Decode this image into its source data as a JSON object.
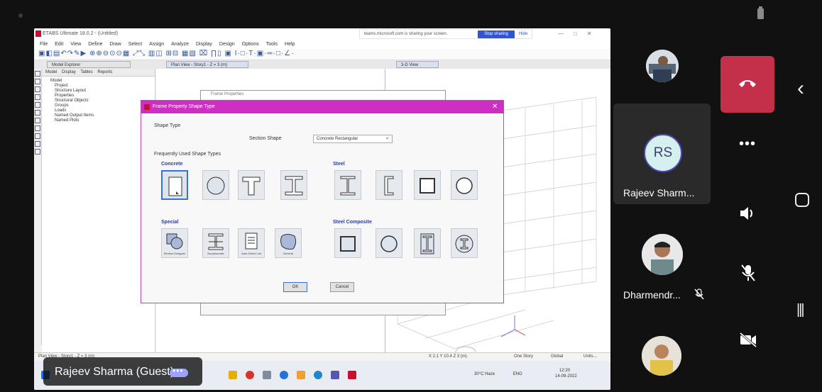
{
  "shared_window": {
    "app_title": "ETABS Ultimate 18.0.2 - (Untitled)",
    "share_banner": {
      "text": "teams.microsoft.com is sharing your screen.",
      "stop_label": "Stop sharing",
      "hide_label": "Hide"
    },
    "menu": [
      "File",
      "Edit",
      "View",
      "Define",
      "Draw",
      "Select",
      "Assign",
      "Analyze",
      "Display",
      "Design",
      "Options",
      "Tools",
      "Help"
    ],
    "panels": {
      "model_explorer": "Model Explorer",
      "plan_view": "Plan View - Story1 - Z = 3 (m)",
      "view_3d": "3-D View"
    },
    "explorer_tabs": [
      "Model",
      "Display",
      "Tables",
      "Reports"
    ],
    "tree": {
      "root": "Model",
      "children": [
        "Project",
        "Structure Layout",
        "Properties",
        "Structural Objects",
        "Groups",
        "Loads",
        "Named Output Items",
        "Named Plots"
      ]
    },
    "status_left": "Plan View - Story1 - Z = 3 (m)",
    "status_right": "X 2.1 Y 10.4 Z 3 (m)",
    "status_extra": [
      "One Story",
      "Global",
      "Units..."
    ]
  },
  "background_dialog": {
    "title": "Frame Properties"
  },
  "dialog": {
    "title": "Frame Property Shape Type",
    "section_label": "Shape Type",
    "section_shape_label": "Section Shape",
    "section_shape_value": "Concrete Rectangular",
    "frequent_label": "Frequently Used Shape Types",
    "groups": {
      "concrete": {
        "title": "Concrete",
        "shapes": [
          "rectangular",
          "circular",
          "tee",
          "i-section"
        ]
      },
      "steel": {
        "title": "Steel",
        "shapes": [
          "i-section",
          "channel",
          "box",
          "pipe"
        ]
      },
      "special": {
        "title": "Special",
        "shapes": [
          "section-designer",
          "nonprismatic",
          "auto-select",
          "general"
        ],
        "captions": [
          "Section Designer",
          "Nonprismatic",
          "Auto Select List",
          "General"
        ]
      },
      "steel_composite": {
        "title": "Steel Composite",
        "shapes": [
          "filled-box",
          "filled-pipe",
          "encased-rect",
          "encased-circle"
        ]
      }
    },
    "ok_label": "OK",
    "cancel_label": "Cancel"
  },
  "taskbar": {
    "weather": "30°C Haze",
    "lang": "ENG",
    "time": "12:20",
    "date": "14-09-2022"
  },
  "presenter": {
    "name": "Rajeev Sharma (Guest)"
  },
  "participants": [
    {
      "name": "Rajeev Sharm...",
      "initials": "RS"
    },
    {
      "name": "Dharmendr...",
      "muted": true
    }
  ],
  "controls": [
    "hang-up",
    "more",
    "speaker",
    "mic-off",
    "video-off"
  ],
  "colors": {
    "hangup": "#c4304a",
    "dialog_title": "#cc2fc1",
    "initials_ring": "#4e49b8"
  }
}
